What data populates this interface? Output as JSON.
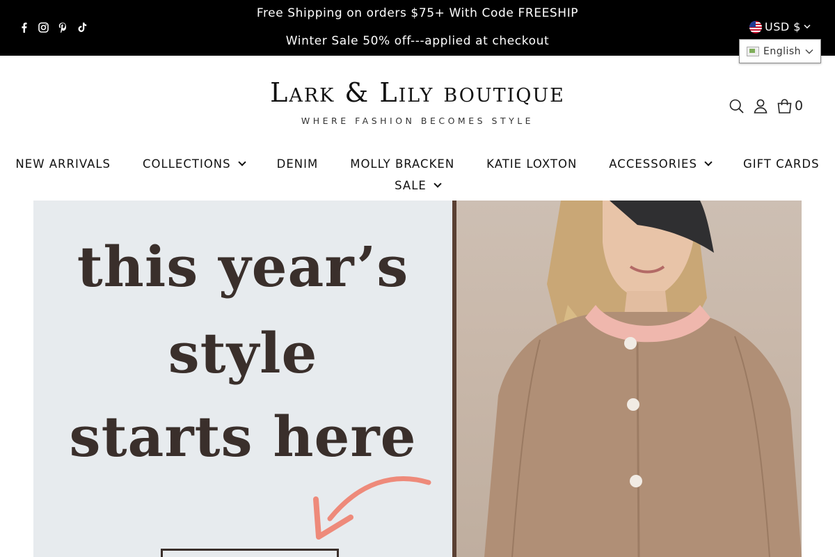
{
  "announcement": {
    "line1": "Free Shipping on orders $75+ With Code FREESHIP",
    "line2": "Winter Sale 50% off---applied at checkout"
  },
  "socials": [
    {
      "name": "facebook-icon"
    },
    {
      "name": "instagram-icon"
    },
    {
      "name": "pinterest-icon"
    },
    {
      "name": "tiktok-icon"
    }
  ],
  "currency": {
    "label": "USD $",
    "flag": "us-flag-icon"
  },
  "language": {
    "label": "English"
  },
  "logo": {
    "title": "Lark & Lily boutique",
    "tagline": "WHERE FASHION BECOMES STYLE"
  },
  "cart": {
    "count": "0"
  },
  "nav": {
    "items": [
      {
        "label": "NEW ARRIVALS",
        "dropdown": false
      },
      {
        "label": "COLLECTIONS",
        "dropdown": true
      },
      {
        "label": "DENIM",
        "dropdown": false
      },
      {
        "label": "MOLLY BRACKEN",
        "dropdown": false
      },
      {
        "label": "KATIE LOXTON",
        "dropdown": false
      },
      {
        "label": "ACCESSORIES",
        "dropdown": true
      },
      {
        "label": "GIFT CARDS",
        "dropdown": false
      },
      {
        "label": "SALE",
        "dropdown": true
      }
    ]
  },
  "hero": {
    "line1": "this year’s",
    "line2": "style",
    "line3": "starts here"
  },
  "colors": {
    "announce_bg": "#000000",
    "hero_left_bg": "#e7ebee",
    "hero_text": "#3a2f2b",
    "arrow": "#ee8a7a"
  }
}
